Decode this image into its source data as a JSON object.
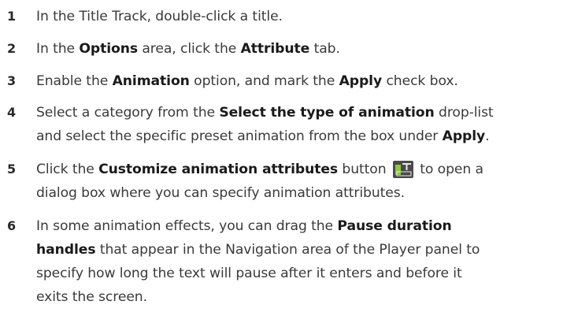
{
  "steps": [
    {
      "number": "1",
      "lines": [
        [
          {
            "t": "In the Title Track, double-click a title."
          }
        ]
      ]
    },
    {
      "number": "2",
      "lines": [
        [
          {
            "t": "In the "
          },
          {
            "t": "Options",
            "b": true
          },
          {
            "t": " area, click the "
          },
          {
            "t": "Attribute",
            "b": true
          },
          {
            "t": " tab."
          }
        ]
      ]
    },
    {
      "number": "3",
      "lines": [
        [
          {
            "t": "Enable the "
          },
          {
            "t": "Animation",
            "b": true
          },
          {
            "t": " option, and mark the "
          },
          {
            "t": "Apply",
            "b": true
          },
          {
            "t": " check box."
          }
        ]
      ]
    },
    {
      "number": "4",
      "lines": [
        [
          {
            "t": "Select a category from the "
          },
          {
            "t": "Select the type of animation",
            "b": true
          },
          {
            "t": " drop-list"
          }
        ],
        [
          {
            "t": "and select the specific preset animation from the box under "
          },
          {
            "t": "Apply",
            "b": true
          },
          {
            "t": "."
          }
        ]
      ]
    },
    {
      "number": "5",
      "lines": [
        [
          {
            "t": "Click the "
          },
          {
            "t": "Customize animation attributes",
            "b": true
          },
          {
            "t": " button "
          },
          {
            "icon": "customize-animation-icon"
          },
          {
            "t": " to open a"
          }
        ],
        [
          {
            "t": "dialog box where you can specify animation attributes."
          }
        ]
      ]
    },
    {
      "number": "6",
      "lines": [
        [
          {
            "t": "In some animation effects, you can drag the "
          },
          {
            "t": "Pause duration",
            "b": true
          }
        ],
        [
          {
            "t": "handles",
            "b": true
          },
          {
            "t": " that appear in the Navigation area of the Player panel to"
          }
        ],
        [
          {
            "t": "specify how long the text will pause after it enters and before it"
          }
        ],
        [
          {
            "t": "exits the screen."
          }
        ]
      ]
    }
  ],
  "icon_colors": {
    "background": "#4a4a4a",
    "accent": "#8fc63f",
    "glyph": "#e8e8e8"
  }
}
